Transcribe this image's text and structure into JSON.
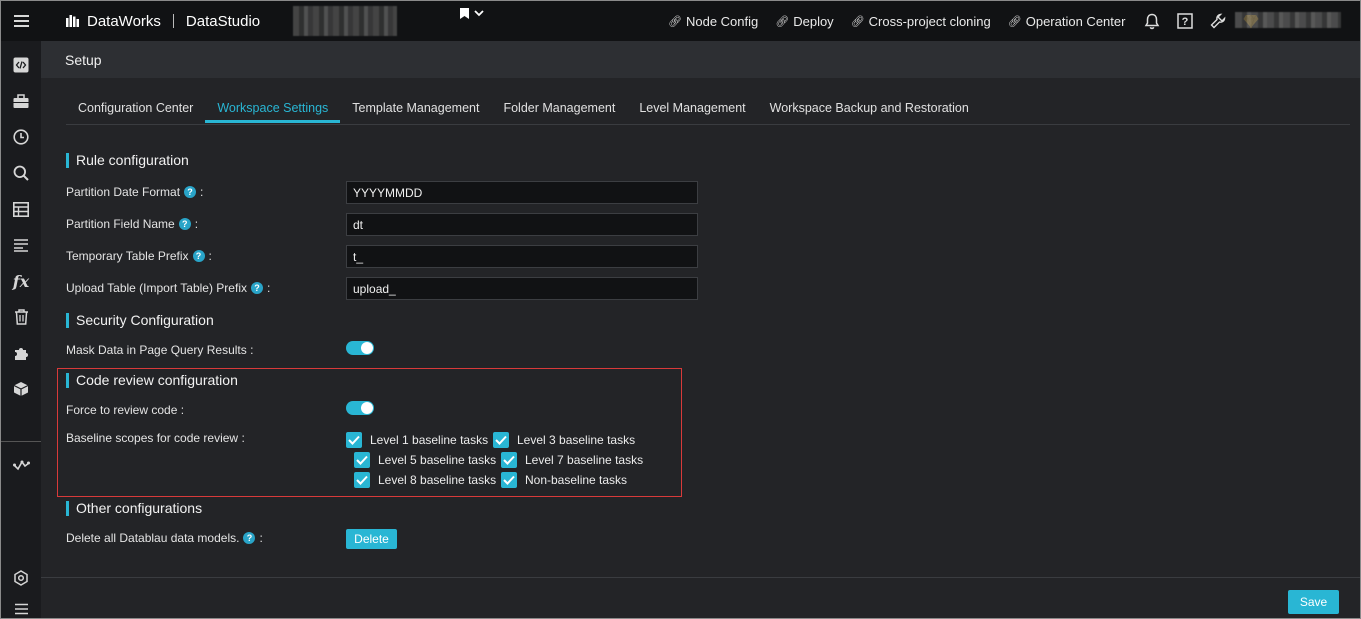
{
  "topbar": {
    "brand": "DataWorks",
    "app": "DataStudio",
    "links": [
      {
        "label": "Node Config"
      },
      {
        "label": "Deploy"
      },
      {
        "label": "Cross-project cloning"
      },
      {
        "label": "Operation Center"
      }
    ],
    "icons": [
      "bell-icon",
      "help-icon",
      "wrench-icon",
      "diamond-icon"
    ]
  },
  "sidebar": {
    "icons": [
      "code-icon",
      "briefcase-icon",
      "clock-icon",
      "search-icon",
      "table-icon",
      "list-icon",
      "function-icon",
      "trash-icon",
      "puzzle-icon",
      "cube-icon",
      "flow-icon"
    ],
    "bottom_icons": [
      "settings-icon",
      "menu-icon"
    ]
  },
  "page": {
    "title": "Setup"
  },
  "tabs": [
    {
      "label": "Configuration Center",
      "active": false
    },
    {
      "label": "Workspace Settings",
      "active": true
    },
    {
      "label": "Template Management",
      "active": false
    },
    {
      "label": "Folder Management",
      "active": false
    },
    {
      "label": "Level Management",
      "active": false
    },
    {
      "label": "Workspace Backup and Restoration",
      "active": false
    }
  ],
  "rule_config": {
    "title": "Rule configuration",
    "fields": [
      {
        "label": "Partition Date Format",
        "value": "YYYYMMDD"
      },
      {
        "label": "Partition Field Name",
        "value": "dt"
      },
      {
        "label": "Temporary Table Prefix",
        "value": "t_"
      },
      {
        "label": "Upload Table (Import Table) Prefix",
        "value": "upload_"
      }
    ]
  },
  "security_config": {
    "title": "Security Configuration",
    "mask_label": "Mask Data in Page Query Results",
    "mask_enabled": true
  },
  "code_review": {
    "title": "Code review configuration",
    "force_label": "Force to review code",
    "force_enabled": true,
    "scopes_label": "Baseline scopes for code review",
    "scopes": [
      {
        "label": "Level 1 baseline tasks",
        "checked": true
      },
      {
        "label": "Level 3 baseline tasks",
        "checked": true
      },
      {
        "label": "Level 5 baseline tasks",
        "checked": true
      },
      {
        "label": "Level 7 baseline tasks",
        "checked": true
      },
      {
        "label": "Level 8 baseline tasks",
        "checked": true
      },
      {
        "label": "Non-baseline tasks",
        "checked": true
      }
    ]
  },
  "other_config": {
    "title": "Other configurations",
    "delete_label": "Delete all Datablau data models.",
    "delete_button": "Delete"
  },
  "footer": {
    "save_button": "Save"
  },
  "colors": {
    "accent": "#29b6d4",
    "highlight_border": "#d83a3a",
    "background": "#232427"
  },
  "colon": ":"
}
